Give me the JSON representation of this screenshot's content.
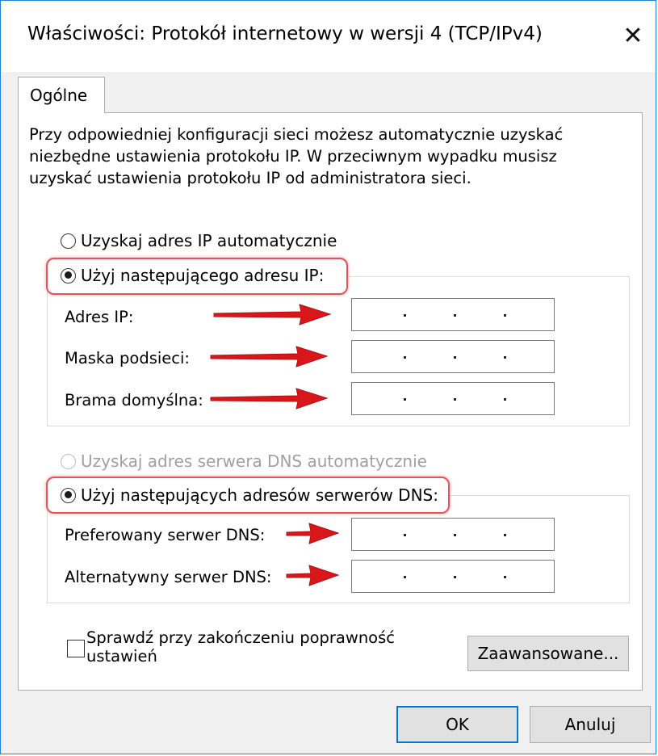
{
  "window": {
    "title": "Właściwości: Protokół internetowy w wersji 4 (TCP/IPv4)",
    "close_symbol": "✕"
  },
  "tabs": [
    {
      "label": "Ogólne",
      "selected": true
    }
  ],
  "description": [
    "Przy odpowiedniej konfiguracji sieci możesz automatycznie uzyskać",
    "niezbędne ustawienia protokołu IP. W przeciwnym wypadku musisz",
    "uzyskać ustawienia protokołu IP od administratora sieci."
  ],
  "ip_section": {
    "auto_label": "Uzyskaj adres IP automatycznie",
    "auto_checked": false,
    "manual_label": "Użyj następującego adresu IP:",
    "manual_checked": true,
    "fields": [
      {
        "label": "Adres IP:",
        "value": ""
      },
      {
        "label": "Maska podsieci:",
        "value": ""
      },
      {
        "label": "Brama domyślna:",
        "value": ""
      }
    ]
  },
  "dns_section": {
    "auto_label": "Uzyskaj adres serwera DNS automatycznie",
    "auto_checked": false,
    "auto_disabled": true,
    "manual_label": "Użyj następujących adresów serwerów DNS:",
    "manual_checked": true,
    "fields": [
      {
        "label": "Preferowany serwer DNS:",
        "value": ""
      },
      {
        "label": "Alternatywny serwer DNS:",
        "value": ""
      }
    ]
  },
  "validate": {
    "label_line1": "Sprawdź przy zakończeniu poprawność",
    "label_line2": "ustawień",
    "checked": false
  },
  "buttons": {
    "advanced": "Zaawansowane...",
    "ok": "OK",
    "cancel": "Anuluj"
  },
  "colors": {
    "highlight": "#e0555a",
    "arrow": "#d9171b",
    "window_border": "#1e84d6",
    "default_button_border": "#0078d7"
  },
  "icons": {
    "close": "close-icon",
    "arrow": "red-arrow-icon"
  }
}
